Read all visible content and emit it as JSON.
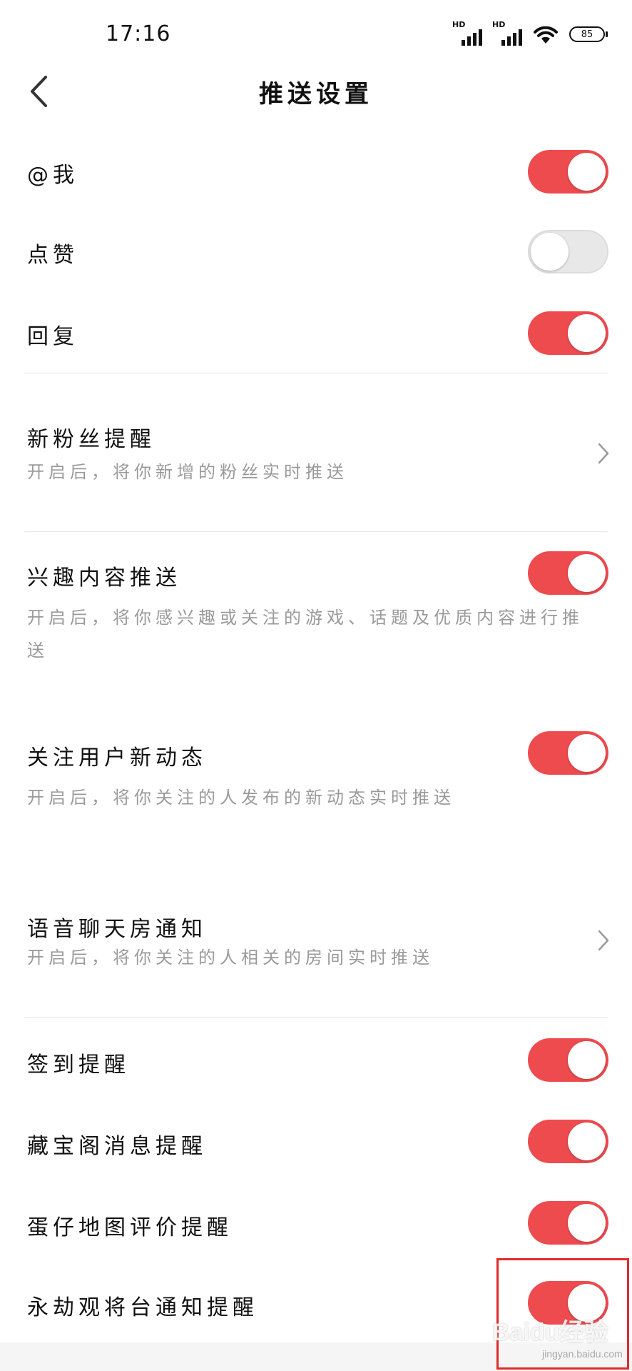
{
  "status_bar": {
    "time": "17:16",
    "battery": "85",
    "signal_1_label": "HD",
    "signal_2_label": "HD"
  },
  "nav": {
    "title": "推送设置"
  },
  "settings": {
    "at_me": {
      "title": "@我",
      "enabled": true
    },
    "likes": {
      "title": "点赞",
      "enabled": false
    },
    "reply": {
      "title": "回复",
      "enabled": true
    },
    "new_fans": {
      "title": "新粉丝提醒",
      "desc": "开启后，将你新增的粉丝实时推送"
    },
    "interest_push": {
      "title": "兴趣内容推送",
      "desc": "开启后，将你感兴趣或关注的游戏、话题及优质内容进行推送",
      "enabled": true
    },
    "follow_updates": {
      "title": "关注用户新动态",
      "desc": "开启后，将你关注的人发布的新动态实时推送",
      "enabled": true
    },
    "voice_room": {
      "title": "语音聊天房通知",
      "desc": "开启后，将你关注的人相关的房间实时推送"
    },
    "checkin": {
      "title": "签到提醒",
      "enabled": true
    },
    "treasure": {
      "title": "藏宝阁消息提醒",
      "enabled": true
    },
    "egg_map": {
      "title": "蛋仔地图评价提醒",
      "enabled": true
    },
    "yongjie": {
      "title": "永劫观将台通知提醒",
      "enabled": true
    }
  },
  "colors": {
    "toggle_on": "#ee4b4f",
    "toggle_off": "#e8e8e8",
    "highlight": "#e32a2a"
  },
  "watermark": {
    "text": "Baidu经验",
    "url": "jingyan.baidu.com"
  }
}
